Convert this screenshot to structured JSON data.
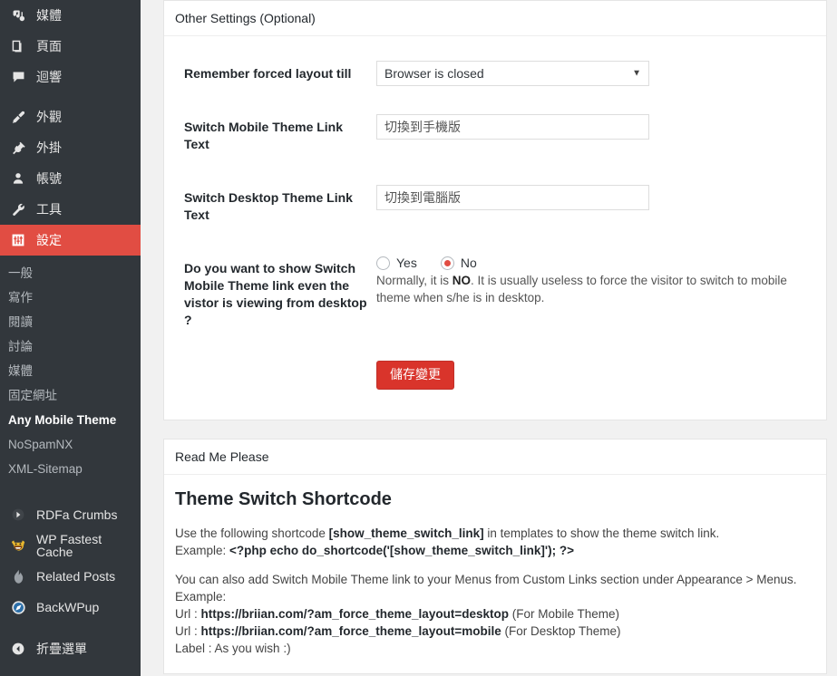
{
  "sidebar": {
    "menu": [
      {
        "label": "媒體",
        "icon": "media-icon",
        "active": false
      },
      {
        "label": "頁面",
        "icon": "pages-icon",
        "active": false
      },
      {
        "label": "迴響",
        "icon": "comments-icon",
        "active": false
      },
      {
        "label": "外觀",
        "icon": "appearance-brush-icon",
        "active": false
      },
      {
        "label": "外掛",
        "icon": "plugins-plug-icon",
        "active": false
      },
      {
        "label": "帳號",
        "icon": "users-icon",
        "active": false
      },
      {
        "label": "工具",
        "icon": "tools-wrench-icon",
        "active": false
      },
      {
        "label": "設定",
        "icon": "settings-sliders-icon",
        "active": true
      }
    ],
    "submenu": [
      {
        "label": "一般",
        "current": false
      },
      {
        "label": "寫作",
        "current": false
      },
      {
        "label": "閱讀",
        "current": false
      },
      {
        "label": "討論",
        "current": false
      },
      {
        "label": "媒體",
        "current": false
      },
      {
        "label": "固定網址",
        "current": false
      },
      {
        "label": "Any Mobile Theme",
        "current": true
      },
      {
        "label": "NoSpamNX",
        "current": false
      },
      {
        "label": "XML-Sitemap",
        "current": false
      }
    ],
    "plugins": [
      {
        "label": "RDFa Crumbs",
        "icon": "rdfa-crumbs-icon"
      },
      {
        "label": "WP Fastest Cache",
        "icon": "wp-fastest-cache-tiger-icon"
      },
      {
        "label": "Related Posts",
        "icon": "related-posts-flame-icon"
      },
      {
        "label": "BackWPup",
        "icon": "backwpup-icon"
      }
    ],
    "collapse": {
      "label": "折疊選單",
      "icon": "collapse-arrow-icon"
    },
    "colors": {
      "background": "#32373c",
      "active_background": "#e14d43",
      "text": "#e5e5e5",
      "submenu_text": "#b4b9be"
    }
  },
  "settings_box": {
    "title": "Other Settings (Optional)",
    "fields": {
      "remember_layout": {
        "label": "Remember forced layout till",
        "selected": "Browser is closed",
        "options": [
          "Browser is closed"
        ]
      },
      "mobile_link_text": {
        "label": "Switch Mobile Theme Link Text",
        "value": "切換到手機版",
        "placeholder": ""
      },
      "desktop_link_text": {
        "label": "Switch Desktop Theme Link Text",
        "value": "切換到電腦版",
        "placeholder": ""
      },
      "show_switch_on_desktop": {
        "label": "Do you want to show Switch Mobile Theme link even the vistor is viewing from desktop ?",
        "options": [
          {
            "label": "Yes",
            "checked": false
          },
          {
            "label": "No",
            "checked": true
          }
        ],
        "description_before": "Normally, it is ",
        "description_bold": "NO",
        "description_after": ". It is usually useless to force the visitor to switch to mobile theme when s/he is in desktop."
      }
    },
    "save_button": "儲存變更",
    "save_button_color": "#d9342b"
  },
  "readme_box": {
    "title": "Read Me Please",
    "heading": "Theme Switch Shortcode",
    "para1_line1_pre": "Use the following shortcode ",
    "para1_line1_code": "[show_theme_switch_link]",
    "para1_line1_post": " in templates to show the theme switch link.",
    "para1_line2_pre": "Example: ",
    "para1_line2_code": "<?php echo do_shortcode('[show_theme_switch_link]'); ?>",
    "para2_line1": "You can also add Switch Mobile Theme link to your Menus from Custom Links section under Appearance > Menus.",
    "para2_line2": "Example:",
    "url_rows": [
      {
        "prefix": "Url : ",
        "url": "https://briian.com/?am_force_theme_layout=desktop",
        "suffix": " (For Mobile Theme)"
      },
      {
        "prefix": "Url : ",
        "url": "https://briian.com/?am_force_theme_layout=mobile",
        "suffix": " (For Desktop Theme)"
      }
    ],
    "label_row": "Label : As you wish :)"
  }
}
